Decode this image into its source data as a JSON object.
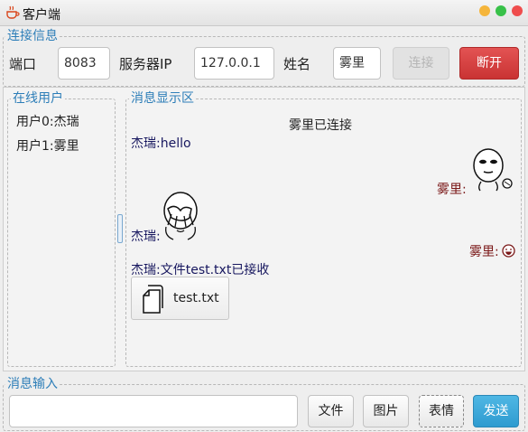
{
  "window": {
    "title": "客户端"
  },
  "connection": {
    "legend": "连接信息",
    "port_label": "端口",
    "port_value": "8083",
    "server_label": "服务器IP",
    "server_value": "127.0.0.1",
    "name_label": "姓名",
    "name_value": "雾里",
    "connect_label": "连接",
    "disconnect_label": "断开"
  },
  "online_users": {
    "legend": "在线用户",
    "items": [
      "用户0:杰瑞",
      "用户1:雾里"
    ]
  },
  "messages": {
    "legend": "消息显示区",
    "system_notice": "雾里已连接",
    "entries": [
      {
        "sender": "杰瑞:",
        "text": "hello"
      },
      {
        "sender": "雾里:",
        "text": "",
        "sticker": "thinking-face-sticker"
      },
      {
        "sender": "杰瑞:",
        "text": "",
        "sticker": "facepalm-sticker"
      },
      {
        "sender": "雾里:",
        "text": "",
        "emoji": "grin-emoji"
      },
      {
        "sender": "杰瑞:",
        "text": "文件test.txt已接收"
      }
    ],
    "file_card": {
      "filename": "test.txt",
      "icon": "file-icon"
    }
  },
  "input": {
    "legend": "消息输入",
    "value": "",
    "file_label": "文件",
    "image_label": "图片",
    "emoji_label": "表情",
    "send_label": "发送"
  },
  "colors": {
    "legend_blue": "#2d7eb8",
    "disconnect_red": "#d23b3b",
    "send_blue": "#3aa8da",
    "sender_dark_blue": "#17175f",
    "sender_dark_red": "#7a1717"
  }
}
